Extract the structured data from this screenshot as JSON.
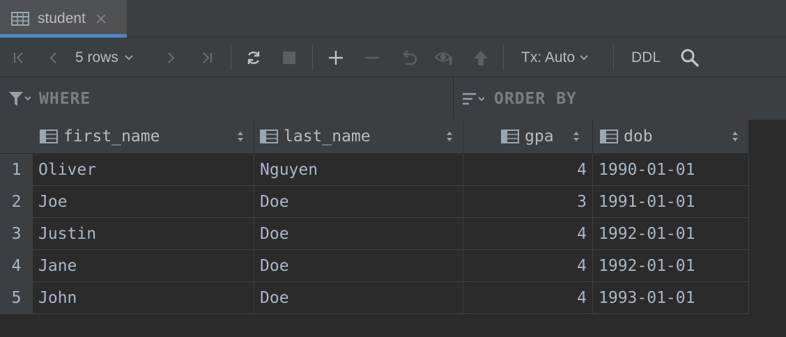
{
  "tab": {
    "label": "student",
    "icon": "table-icon"
  },
  "toolbar": {
    "rows_label": "5 rows",
    "tx_label": "Tx: Auto",
    "ddl_label": "DDL"
  },
  "filter": {
    "where_label": "WHERE",
    "order_label": "ORDER BY"
  },
  "grid": {
    "columns": [
      {
        "name": "first_name",
        "align": "left"
      },
      {
        "name": "last_name",
        "align": "left"
      },
      {
        "name": "gpa",
        "align": "right"
      },
      {
        "name": "dob",
        "align": "left"
      }
    ],
    "rows": [
      {
        "num": "1",
        "cells": [
          "Oliver",
          "Nguyen",
          "4",
          "1990-01-01"
        ]
      },
      {
        "num": "2",
        "cells": [
          "Joe",
          "Doe",
          "3",
          "1991-01-01"
        ]
      },
      {
        "num": "3",
        "cells": [
          "Justin",
          "Doe",
          "4",
          "1992-01-01"
        ]
      },
      {
        "num": "4",
        "cells": [
          "Jane",
          "Doe",
          "4",
          "1992-01-01"
        ]
      },
      {
        "num": "5",
        "cells": [
          "John",
          "Doe",
          "4",
          "1993-01-01"
        ]
      }
    ]
  },
  "colors": {
    "accent": "#4a88c7",
    "background": "#2b2b2b",
    "panel": "#3c3f41"
  }
}
